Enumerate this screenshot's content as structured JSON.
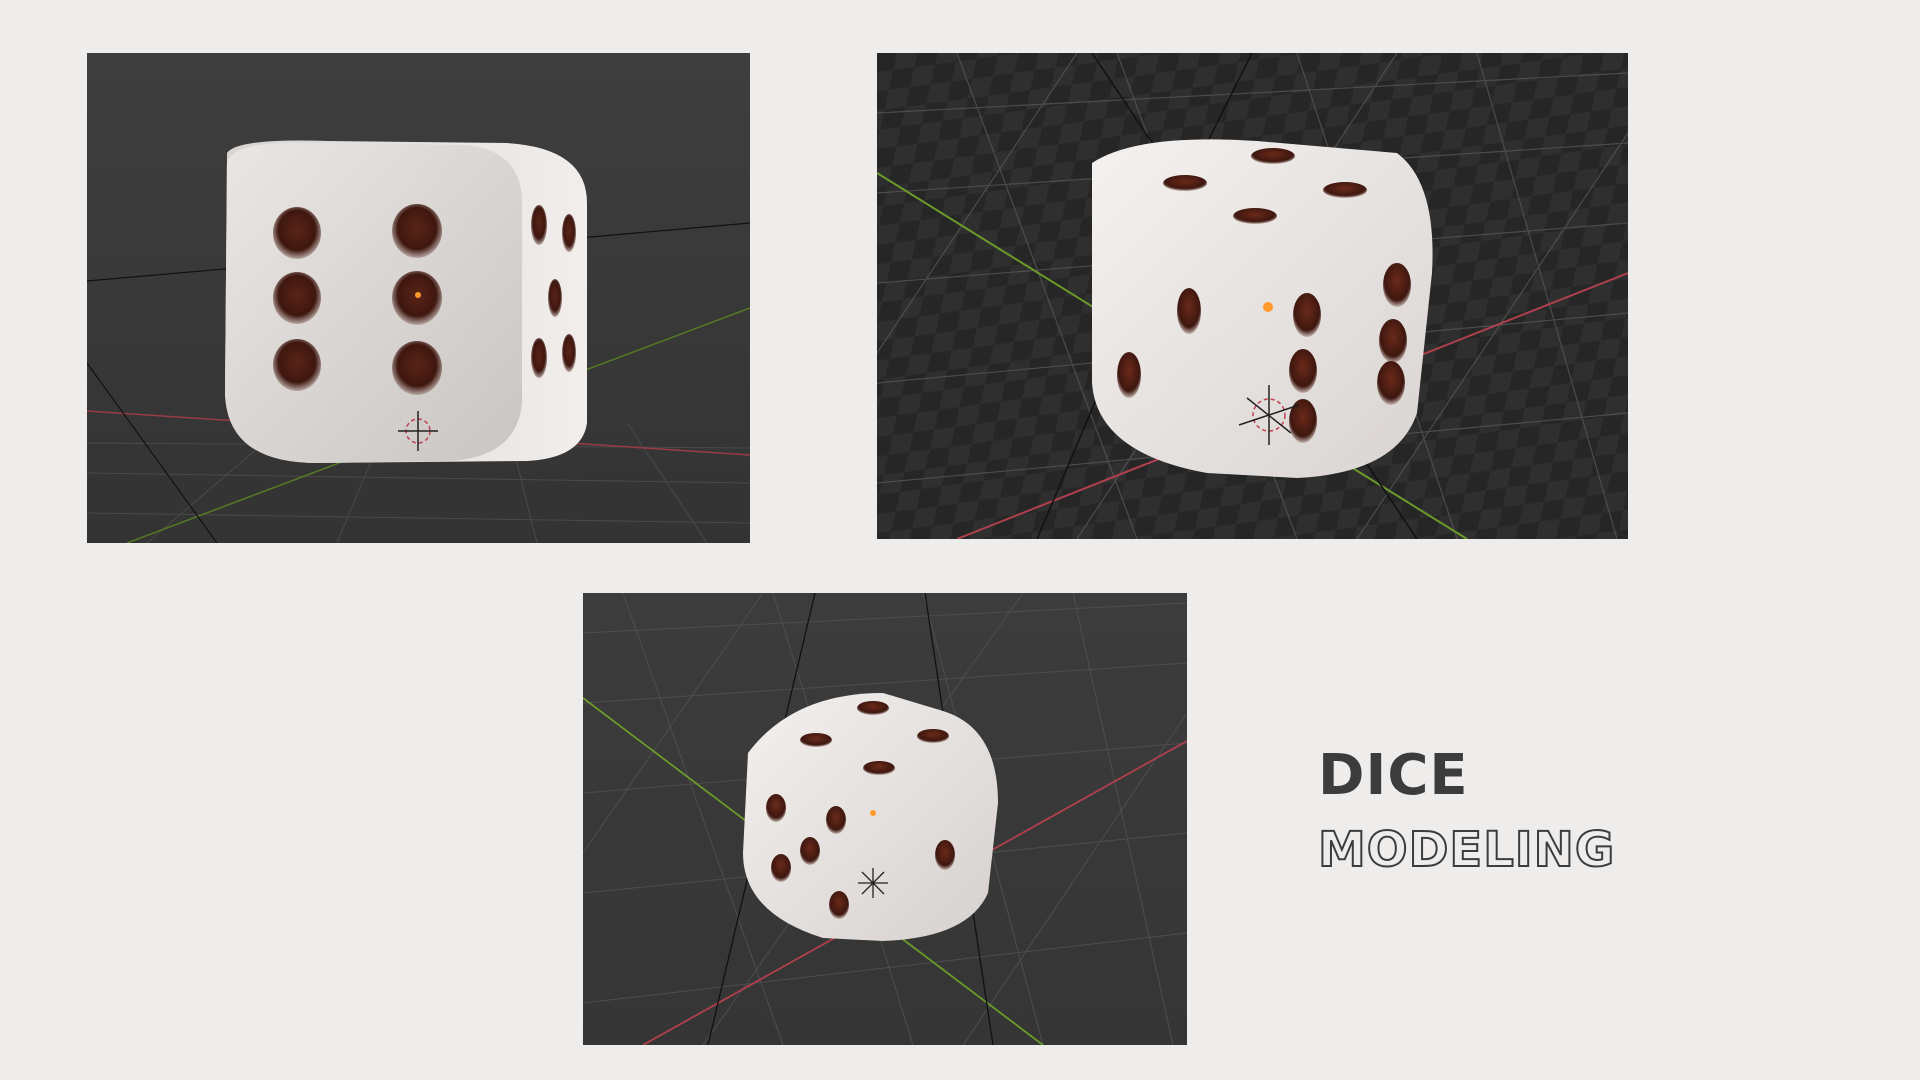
{
  "heading": {
    "title": "DICE",
    "subtitle": "MODELING"
  },
  "renders": [
    {
      "view": "front-face-six"
    },
    {
      "view": "corner-checkerboard"
    },
    {
      "view": "corner-grid"
    }
  ],
  "colors": {
    "background": "#efecec",
    "viewport": "#3a3a3a",
    "die_body": "#e9e5e3",
    "pip": "#4a2016",
    "title": "#3c3c3c",
    "x_axis": "#b0404e",
    "y_axis": "#6a9a2a"
  }
}
